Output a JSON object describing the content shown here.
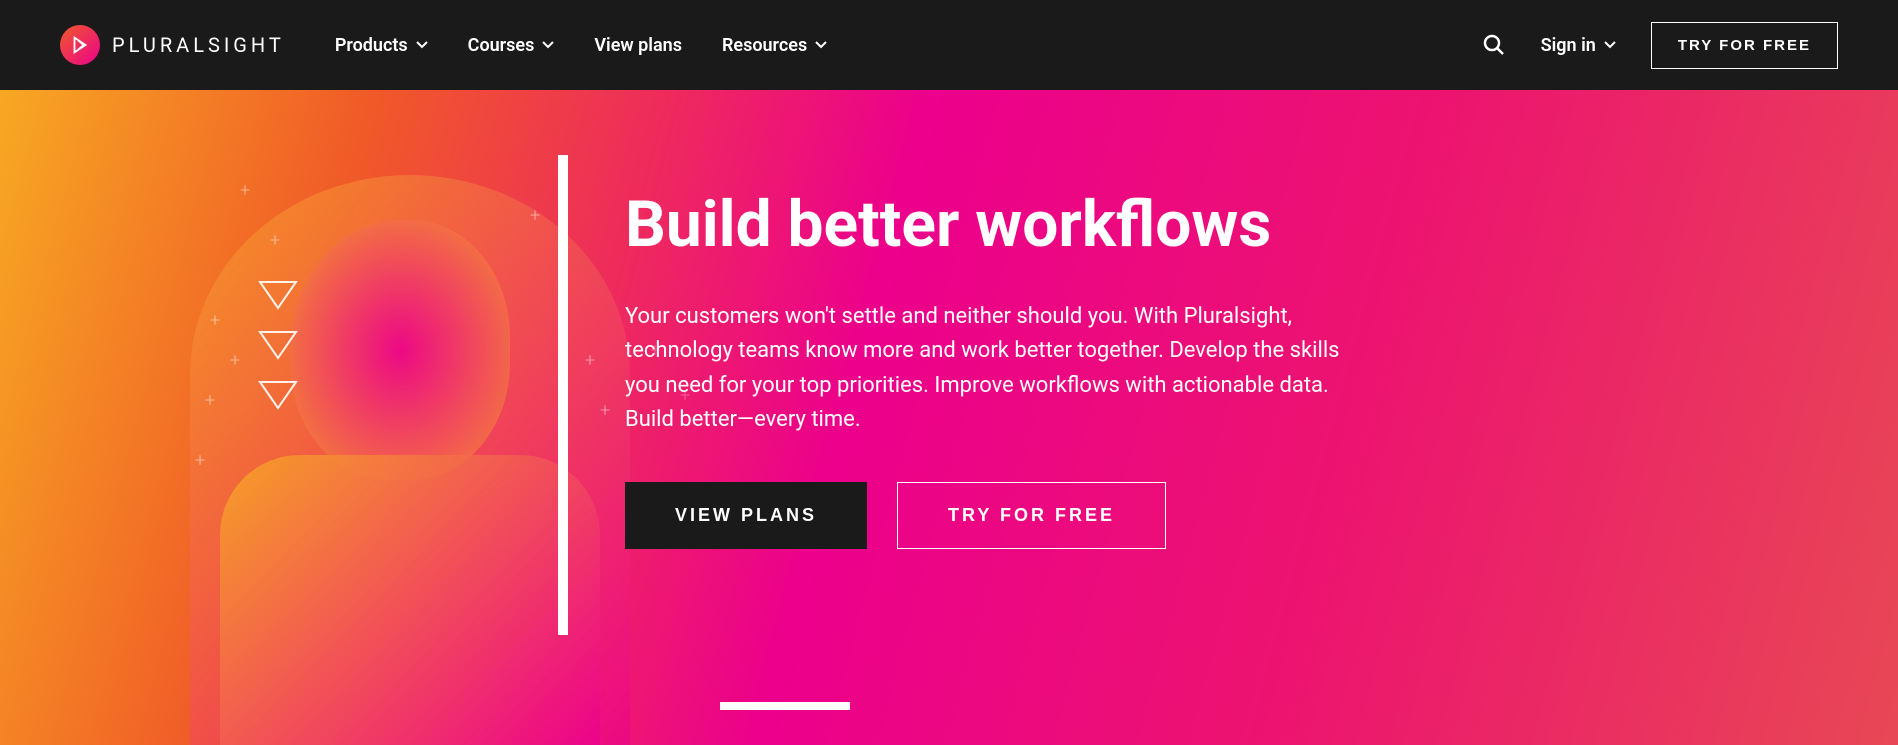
{
  "brand": {
    "name": "PLURALSIGHT"
  },
  "nav": {
    "items": [
      {
        "label": "Products",
        "hasDropdown": true
      },
      {
        "label": "Courses",
        "hasDropdown": true
      },
      {
        "label": "View plans",
        "hasDropdown": false
      },
      {
        "label": "Resources",
        "hasDropdown": true
      }
    ]
  },
  "header": {
    "signin": "Sign in",
    "tryFree": "TRY FOR FREE"
  },
  "hero": {
    "title": "Build better workflows",
    "description": "Your customers won't settle and neither should you. With Pluralsight, technology teams know more and work better together. Develop the skills you need for your top priorities. Improve workflows with actionable data. Build better—every time.",
    "primaryCta": "VIEW PLANS",
    "secondaryCta": "TRY FOR FREE"
  }
}
